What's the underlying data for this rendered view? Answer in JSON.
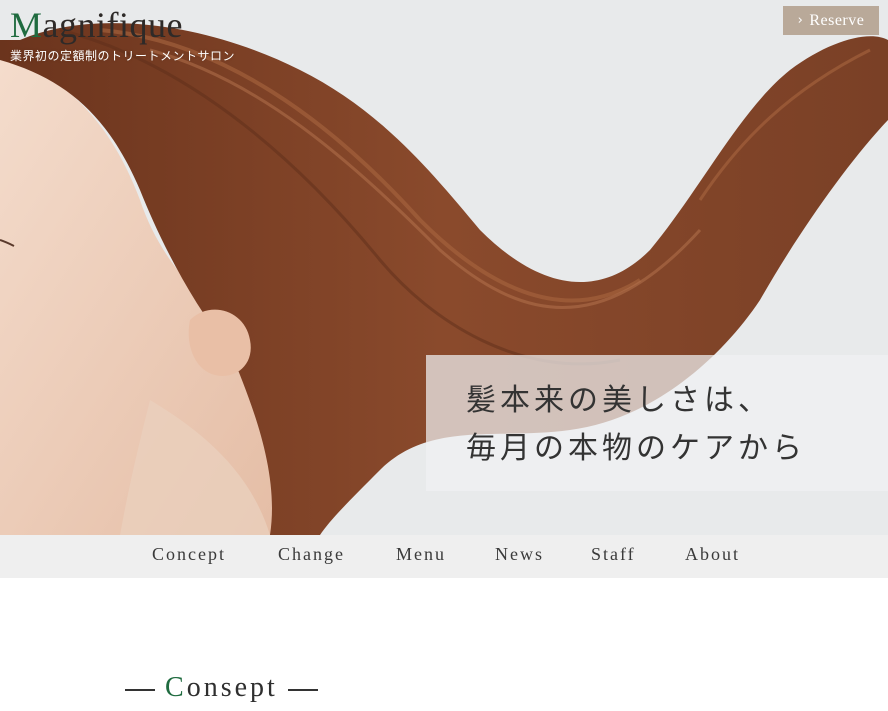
{
  "header": {
    "logo_first_letter": "M",
    "logo_rest": "agnifique",
    "tagline": "業界初の定額制のトリートメントサロン",
    "reserve_label": "Reserve",
    "reserve_icon": "chevron-right-icon"
  },
  "hero": {
    "catch_line_1": "髪本来の美しさは、",
    "catch_line_2": "毎月の本物のケアから"
  },
  "nav": {
    "items": [
      {
        "label": "Concept"
      },
      {
        "label": "Change"
      },
      {
        "label": "Menu"
      },
      {
        "label": "News"
      },
      {
        "label": "Staff"
      },
      {
        "label": "About"
      }
    ]
  },
  "section": {
    "title_first_letter": "C",
    "title_rest": "onsept"
  },
  "colors": {
    "accent_green": "#1f6b3f",
    "reserve_bg": "#b9a999",
    "nav_bg": "#efefef",
    "text": "#333333"
  }
}
